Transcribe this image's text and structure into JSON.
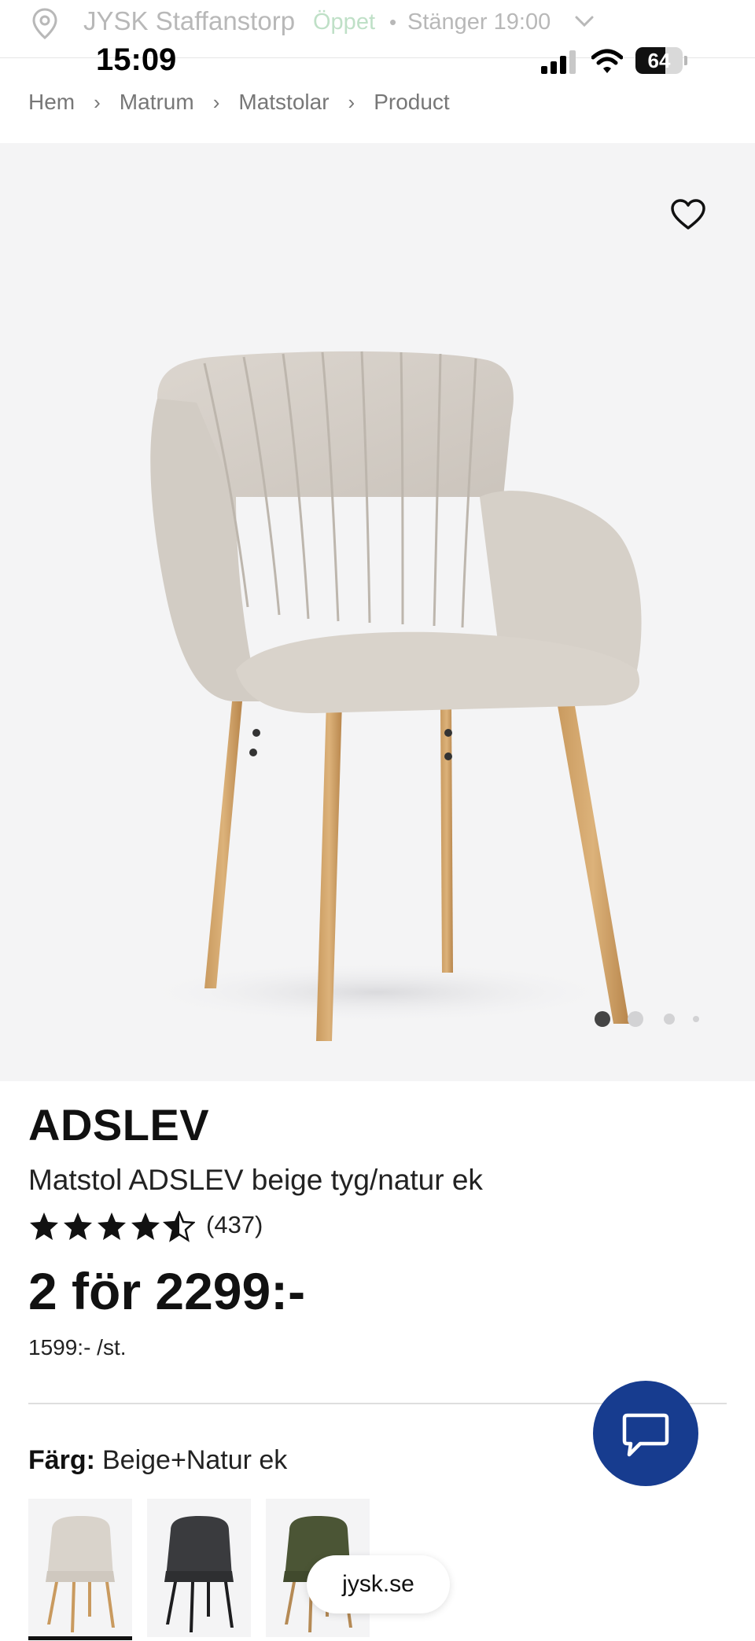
{
  "store_bar": {
    "store_name": "JYSK Staffanstorp",
    "open_status": "Öppet",
    "separator": "•",
    "closing_time": "Stänger 19:00",
    "icons": [
      "location-pin-icon",
      "chevron-down-icon"
    ]
  },
  "status_bar": {
    "time": "15:09",
    "battery_level": "64",
    "icons": [
      "cellular-signal-icon",
      "wifi-icon",
      "battery-icon"
    ]
  },
  "breadcrumb": {
    "items": [
      "Hem",
      "Matrum",
      "Matstolar",
      "Product"
    ],
    "separator": "›"
  },
  "gallery": {
    "image_alt": "Matstol ADSLEV beige tyg/natur ek",
    "image_count": 4,
    "active_index": 0,
    "favorite_icon": "heart-outline-icon"
  },
  "product": {
    "name": "ADSLEV",
    "subtitle": "Matstol ADSLEV beige tyg/natur ek",
    "rating": 4.5,
    "rating_max": 5,
    "review_count": "(437)",
    "price": "2 för 2299:-",
    "unit_price": "1599:- /st."
  },
  "color": {
    "label": "Färg:",
    "selected": "Beige+Natur ek",
    "swatches": [
      {
        "name": "Beige+Natur ek",
        "selected": true
      },
      {
        "name": "Mörkgrå",
        "selected": false
      },
      {
        "name": "Olivgrön",
        "selected": false
      }
    ]
  },
  "chat": {
    "icon": "chat-bubble-icon",
    "color": "#173c8f"
  },
  "browser": {
    "url": "jysk.se"
  },
  "colors": {
    "accent_blue": "#173c8f",
    "open_green": "#bfe0c7",
    "text_dark": "#111111",
    "text_muted": "#777777",
    "hero_background": "#f4f4f5"
  }
}
